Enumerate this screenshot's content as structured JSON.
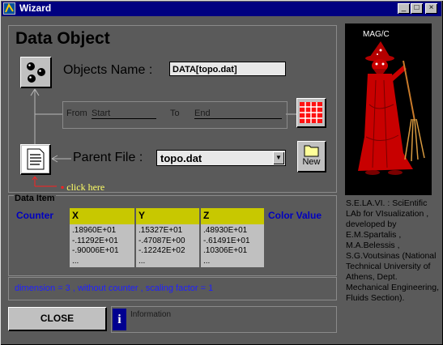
{
  "window": {
    "title": "Wizard",
    "minimize": "_",
    "maximize": "□",
    "close": "×"
  },
  "heading": "Data Object",
  "objects": {
    "label": "Objects Name :",
    "value": "DATA[topo.dat]"
  },
  "range": {
    "from_label": "From",
    "from_value": "Start",
    "to_label": "To",
    "to_value": "End"
  },
  "parent": {
    "label": "Parent File :",
    "value": "topo.dat",
    "new_label": "New"
  },
  "click_here": "click here",
  "data_item": {
    "label": "Data Item",
    "columns": [
      {
        "name": "Counter",
        "cells": []
      },
      {
        "name": "X",
        "cells": [
          ".18960E+01",
          "-.11292E+01",
          "-.90006E+01",
          "..."
        ]
      },
      {
        "name": "Y",
        "cells": [
          ".15327E+01",
          "-.47087E+00",
          "-.12242E+02",
          "..."
        ]
      },
      {
        "name": "Z",
        "cells": [
          ".48930E+01",
          "-.61491E+01",
          ".10306E+01",
          "..."
        ]
      },
      {
        "name": "Color Value",
        "cells": []
      }
    ],
    "dimension_text": "dimension =  3 , without counter , scaling factor = 1"
  },
  "close_label": "CLOSE",
  "info": {
    "icon": "i",
    "text": "Information"
  },
  "magic_caption": "MAG/C",
  "credits": "S.E.LA.VI. : SciEntific LAb for VIsualization , developed by E.M.Spartalis , M.A.Belessis , S.G.Voutsinas (National Technical University of Athens, Dept. Mechanical Engineering, Fluids Section).",
  "colors": {
    "titlebar": "#000080",
    "panel": "#5a5a5a",
    "header_yellow": "#c8c800",
    "header_blue": "#0000c0",
    "link_yellow": "#ffff66",
    "dimension_blue": "#2020ff",
    "magic_red": "#c80000"
  }
}
